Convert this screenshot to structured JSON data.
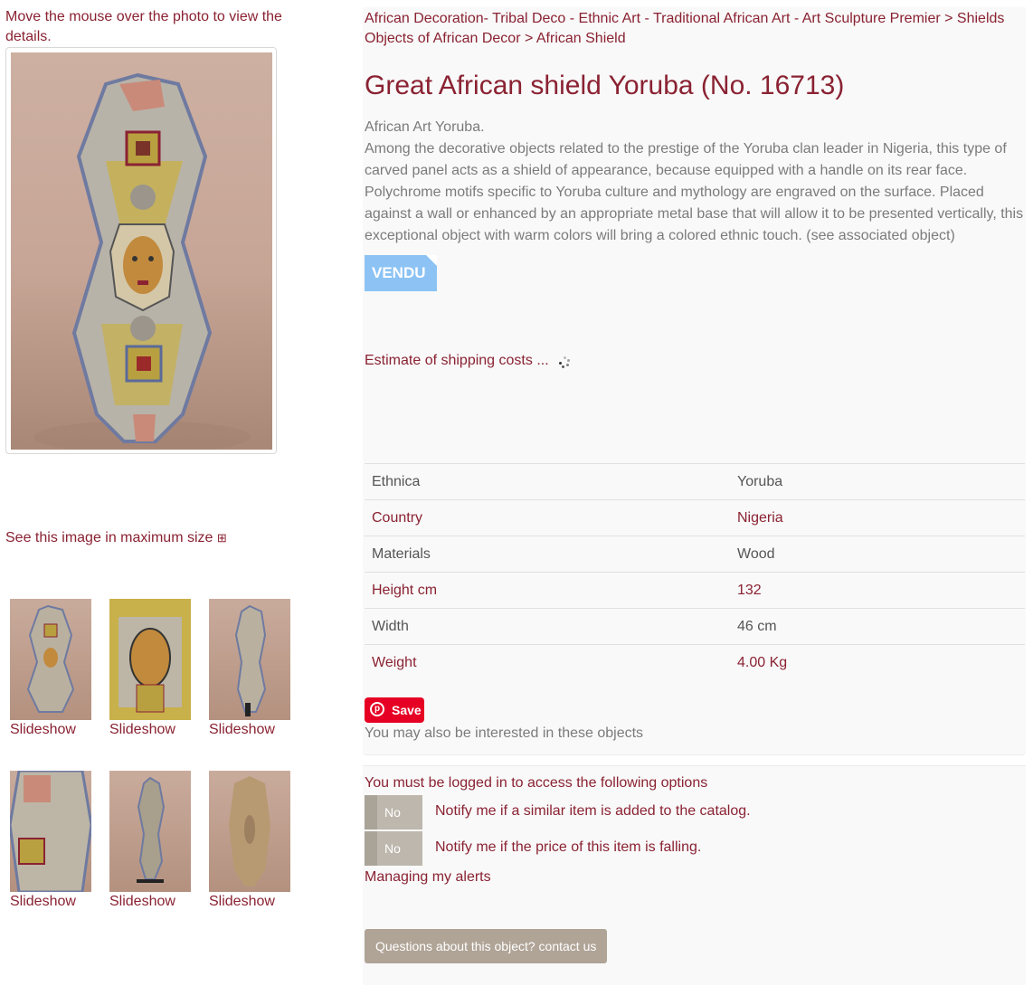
{
  "left": {
    "hint": "Move the mouse over the photo to view the details.",
    "max_size_link": "See this image in maximum size",
    "max_size_icon": "⊞",
    "thumbnails": [
      {
        "label": "Slideshow"
      },
      {
        "label": "Slideshow"
      },
      {
        "label": "Slideshow"
      },
      {
        "label": "Slideshow"
      },
      {
        "label": "Slideshow"
      },
      {
        "label": "Slideshow"
      }
    ]
  },
  "breadcrumb": {
    "part1": "African Decoration- Tribal Deco - Ethnic Art - Traditional African Art - Art Sculpture Premier",
    "sep1": " > ",
    "part2": "Shields Objects of African Decor",
    "sep2": " > ",
    "part3": "African Shield"
  },
  "product": {
    "title": "Great African shield Yoruba (No. 16713)",
    "description_line1": "African Art Yoruba.",
    "description_body": "Among the decorative objects related to the prestige of the Yoruba clan leader in Nigeria, this type of carved panel acts as a shield of appearance, because equipped with a handle on its rear face. Polychrome motifs specific to Yoruba culture and mythology are engraved on the surface. Placed against a wall or enhanced by an appropriate metal base that will allow it to be presented vertically, this exceptional object with warm colors will bring a colored ethnic touch. (see associated object)",
    "sold_badge": "VENDU",
    "shipping_link": "Estimate of shipping costs ..."
  },
  "specs": [
    {
      "key": "Ethnica",
      "value": "Yoruba"
    },
    {
      "key": "Country",
      "value": "Nigeria"
    },
    {
      "key": "Materials",
      "value": "Wood"
    },
    {
      "key": "Height cm",
      "value": "132"
    },
    {
      "key": "Width",
      "value": "46 cm"
    },
    {
      "key": "Weight",
      "value": "4.00 Kg"
    }
  ],
  "pinterest": {
    "save_label": "Save"
  },
  "interested_text": "You may also be interested in these objects",
  "alerts": {
    "logged_notice": "You must be logged in to access the following options",
    "toggle_state": "No",
    "notify_similar": "Notify me if a similar item is added to the catalog.",
    "notify_price": "Notify me if the price of this item is falling.",
    "manage_link": "Managing my alerts",
    "contact_button": "Questions about this object? contact us"
  },
  "colors": {
    "link": "#8a2232",
    "text": "#7b7b7b",
    "sold_badge": "#8cc3f4",
    "pinterest": "#e60023",
    "toggle": "#bdb7ad",
    "contact_button": "#b0a497"
  }
}
